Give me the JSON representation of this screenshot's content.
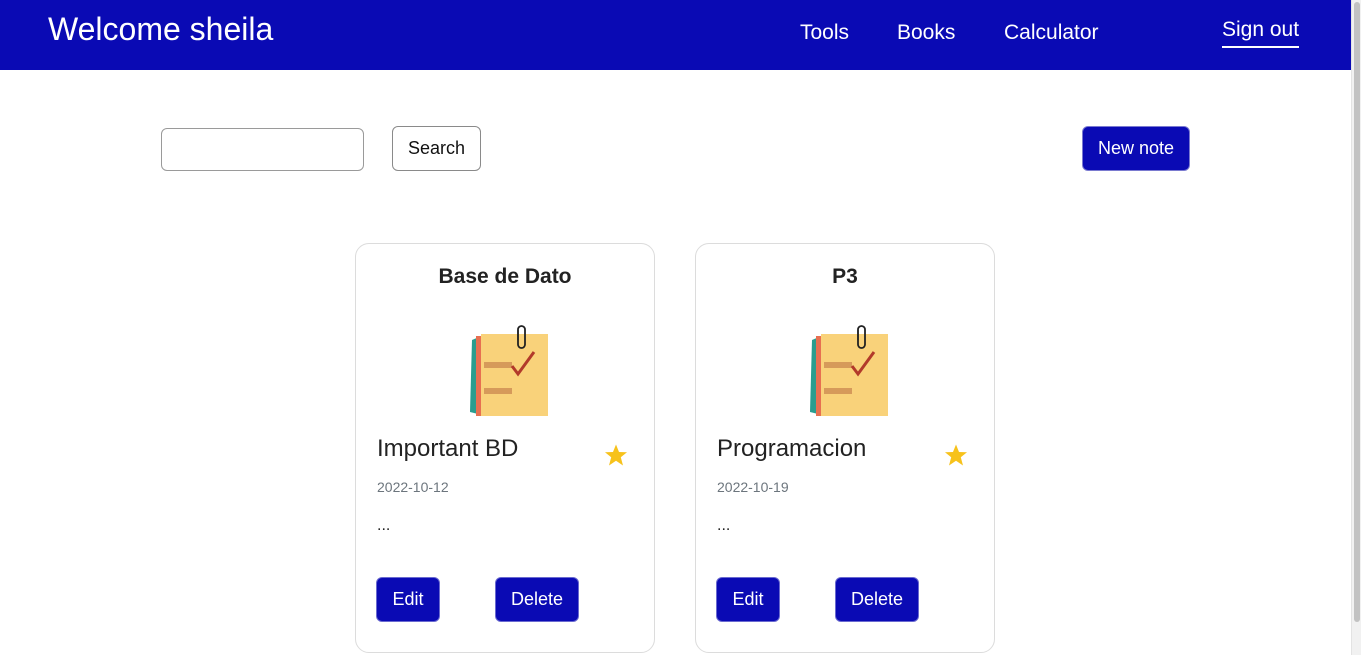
{
  "header": {
    "brand": "Welcome sheila",
    "nav": {
      "tools": "Tools",
      "books": "Books",
      "calculator": "Calculator",
      "sign_out": "Sign out"
    }
  },
  "toolbar": {
    "search_value": "",
    "search_label": "Search",
    "new_note_label": "New note"
  },
  "notes": [
    {
      "title": "Base de Dato",
      "subtitle": "Important BD",
      "date": "2022-10-12",
      "body": "...",
      "starred": true,
      "edit_label": "Edit",
      "delete_label": "Delete"
    },
    {
      "title": "P3",
      "subtitle": "Programacion",
      "date": "2022-10-19",
      "body": "...",
      "starred": true,
      "edit_label": "Edit",
      "delete_label": "Delete"
    }
  ],
  "icons": {
    "note": "sticky-note-icon",
    "star": "star-icon"
  },
  "colors": {
    "primary": "#0a0ab4",
    "star": "#f7c21b"
  }
}
